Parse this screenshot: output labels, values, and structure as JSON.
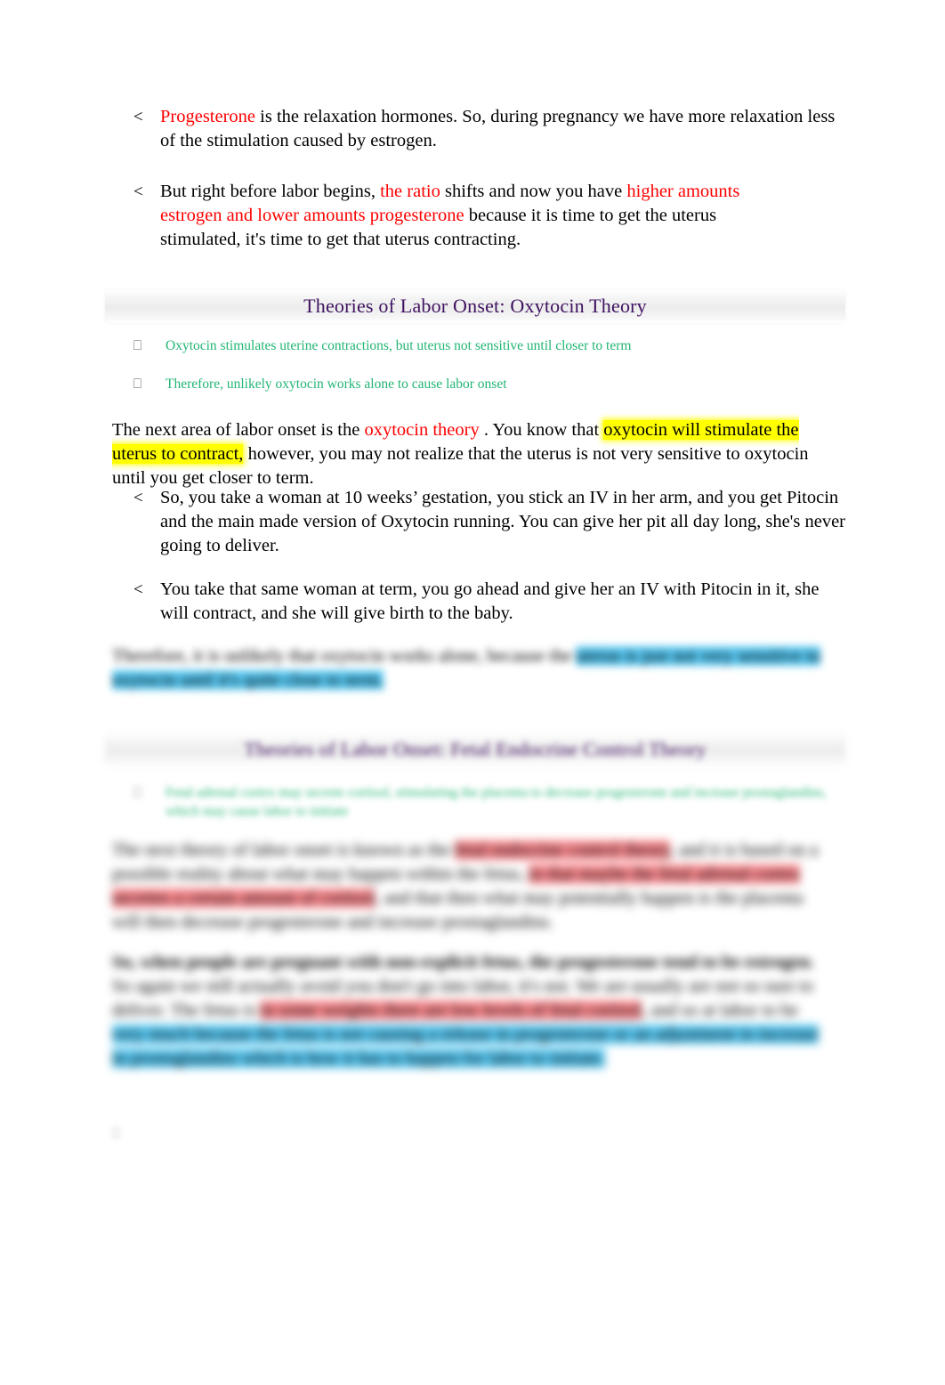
{
  "document": {
    "page_background": "#FFFFFF",
    "colors": {
      "red_accent": "#FF0000",
      "green_accent": "#22B573",
      "purple_title": "#3F1260",
      "highlight_yellow": "#FFFF00",
      "highlight_cyan": "#58C8F2",
      "highlight_red": "#FB8A8F",
      "banner_background": "#EFEFEF"
    }
  },
  "progesterone_bullet": {
    "marker": "<",
    "run_red": "Progesterone",
    "run_plain": " is the relaxation hormones. So, during pregnancy we have more relaxation less of the stimulation caused by estrogen."
  },
  "ratio_bullet": {
    "marker": "<",
    "run_plain_1": "But right before labor begins, ",
    "run_red_1": "the ratio",
    "run_plain_2": " shifts and now you have ",
    "run_red_2": "higher amounts estrogen and lower amounts progesterone",
    "run_plain_3": "  because it is time to get the uterus stimulated, it's time to get that uterus contracting."
  },
  "banner_oxytocin": {
    "title": "Theories of Labor Onset: Oxytocin Theory"
  },
  "oxytocin_slide_bullets": [
    {
      "marker": "⎕",
      "text": "Oxytocin stimulates uterine contractions, but uterus not sensitive until closer to term"
    },
    {
      "marker": "⎕",
      "text": "Therefore, unlikely oxytocin works alone to cause labor onset"
    }
  ],
  "oxytocin_paragraph": {
    "run_plain_1": "The next area of labor onset is the ",
    "run_red_1": " oxytocin theory ",
    "run_plain_2": ". You know that ",
    "run_highlight_1": "oxytocin will stimulate the uterus to contract,",
    "run_plain_3": " however, you may not realize that the uterus is not very sensitive to oxytocin until you get closer to term."
  },
  "pitocin_bullets": [
    {
      "marker": "<",
      "text": "So, you take a woman at 10 weeks’ gestation, you stick an IV in her arm, and you get Pitocin and the main made version of Oxytocin running. You can give her pit all day long, she's never going to deliver."
    },
    {
      "marker": "<",
      "text": "You take that same woman at term, you go ahead and give her an IV with Pitocin in it, she will contract, and she will give birth to the baby."
    }
  ],
  "blurred_conclusion": {
    "run_plain": "Therefore, it is unlikely that oxytocin works alone, because the",
    "run_highlight_cyan": "uterus is just not very sensitive to oxytocin until it's quite close to term."
  },
  "banner_fetal": {
    "title": "Theories of Labor Onset: Fetal Endocrine Control Theory"
  },
  "fetal_slide_bullets": [
    {
      "marker": "⎕",
      "text": "Fetal adrenal cortex may secrete cortisol, stimulating the placenta to decrease progesterone and increase prostaglandins, which may cause labor to initiate"
    }
  ],
  "fetal_paragraph_1": {
    "run_plain_1": "The next theory of labor onset is known as the ",
    "run_highlight_red_1": "fetal endocrine control theory",
    "run_plain_2": ", and it is based on a possible reality about what may happen within the fetus, ",
    "run_highlight_red_2": "in that maybe the fetal adrenal cortex secretes a certain amount of cortisol",
    "run_plain_3": ", and that then what may potentially happen is the placenta will then decrease progesterone and increase prostaglandins."
  },
  "fetal_paragraph_2": {
    "run_bold_1": "So, when people are pregnant with non-explicit fetus, the progesterone tend to be estrogen",
    "run_plain_1": ". So again we still actually avoid you don't go into labor, it's not. We are usually are not so sure to deliver. The fetus is ",
    "run_highlight_red_1": "in some weights there are low levels of fetal cortisol",
    "run_plain_2": ", and so at labor to be ",
    "run_highlight_cyan_1": "very much because the fetus is not causing a release in progesterone or an adjustment in increase in prostaglandins which is how it has to happen for labor to initiate."
  },
  "stray_marker": {
    "glyph": "⎕"
  }
}
